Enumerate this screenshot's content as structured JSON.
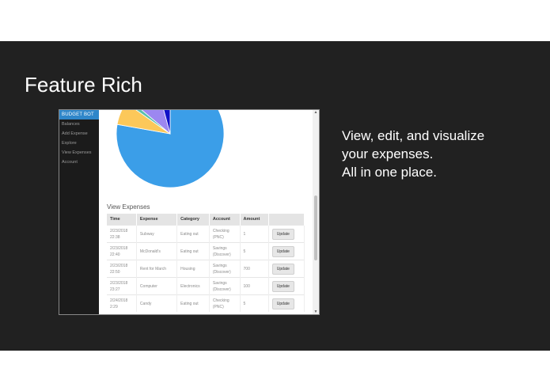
{
  "slide": {
    "title": "Feature Rich",
    "tagline": [
      "View, edit, and visualize",
      "your expenses.",
      "All in one place."
    ]
  },
  "app": {
    "brand": "BUDGET BOT",
    "nav": [
      "Balances",
      "Add Expense",
      "Explore",
      "View Expenses",
      "Account"
    ],
    "section_title": "View Expenses",
    "table": {
      "headers": [
        "Time",
        "Expense",
        "Category",
        "Account",
        "Amount",
        ""
      ],
      "rows": [
        {
          "time1": "2/23/2018",
          "time2": "22:38",
          "expense": "Subway",
          "category": "Eating out",
          "acct1": "Checking",
          "acct2": "(PNC)",
          "amount": "1",
          "action": "Update"
        },
        {
          "time1": "2/23/2018",
          "time2": "22:40",
          "expense": "McDonald's",
          "category": "Eating out",
          "acct1": "Savings",
          "acct2": "(Discover)",
          "amount": "5",
          "action": "Update"
        },
        {
          "time1": "2/23/2018",
          "time2": "22:50",
          "expense": "Rent for March",
          "category": "Housing",
          "acct1": "Savings",
          "acct2": "(Discover)",
          "amount": "700",
          "action": "Update"
        },
        {
          "time1": "2/23/2018",
          "time2": "23:27",
          "expense": "Computer",
          "category": "Electronics",
          "acct1": "Savings",
          "acct2": "(Discover)",
          "amount": "100",
          "action": "Update"
        },
        {
          "time1": "2/24/2018",
          "time2": "2:29",
          "expense": "Candy",
          "category": "Eating out",
          "acct1": "Checking",
          "acct2": "(PNC)",
          "amount": "5",
          "action": "Update"
        }
      ]
    },
    "pie_colors": {
      "blue": "#3b9ee8",
      "yellow": "#fcc85a",
      "teal": "#5cbfae",
      "purple": "#9c87f0",
      "navy": "#1010c8"
    }
  }
}
